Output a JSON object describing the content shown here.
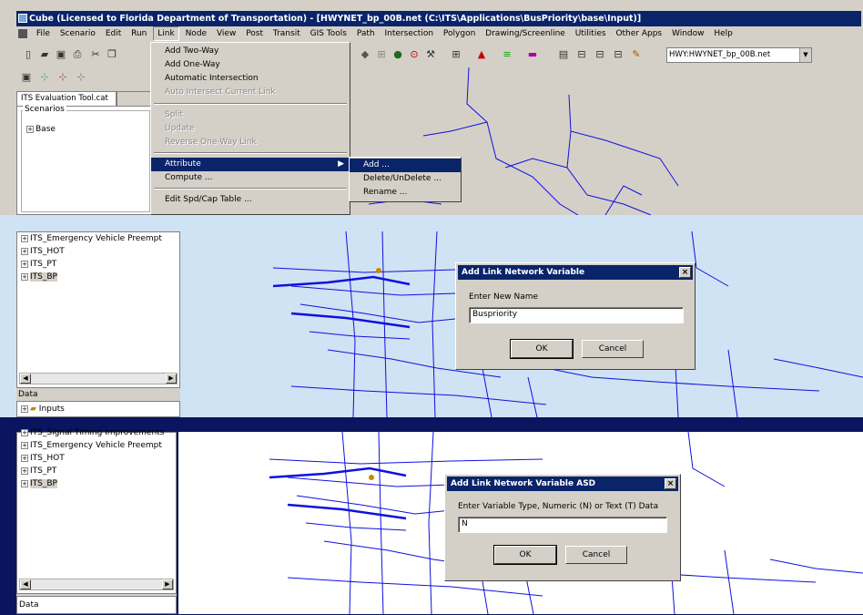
{
  "window": {
    "title": "Cube (Licensed to Florida Department of Transportation) - [HWYNET_bp_00B.net (C:\\ITS\\Applications\\BusPriority\\base\\Input)]"
  },
  "menubar": [
    "File",
    "Scenario",
    "Edit",
    "Run",
    "Link",
    "Node",
    "View",
    "Post",
    "Transit",
    "GIS Tools",
    "Path",
    "Intersection",
    "Polygon",
    "Drawing/Screenline",
    "Utilities",
    "Other Apps",
    "Window",
    "Help"
  ],
  "toolbar": {
    "layer_combo": "HWY:HWYNET_bp_00B.net"
  },
  "catalog_tab": "ITS Evaluation Tool.cat",
  "scenarios": {
    "label": "Scenarios",
    "items": [
      "Base"
    ]
  },
  "link_menu": {
    "items": [
      {
        "label": "Add Two-Way",
        "enabled": true
      },
      {
        "label": "Add One-Way",
        "enabled": true
      },
      {
        "label": "Automatic Intersection",
        "enabled": true
      },
      {
        "label": "Auto Intersect Current Link",
        "enabled": false
      },
      {
        "label": "Split",
        "enabled": false
      },
      {
        "label": "Update",
        "enabled": false
      },
      {
        "label": "Reverse One-Way Link",
        "enabled": false
      },
      {
        "label": "Attribute",
        "enabled": true
      },
      {
        "label": "Compute ...",
        "enabled": true
      },
      {
        "label": "Edit Spd/Cap Table ...",
        "enabled": true
      }
    ]
  },
  "attribute_submenu": [
    "Add ...",
    "Delete/UnDelete ...",
    "Rename ..."
  ],
  "panel2": {
    "tree": [
      "ITS_Emergency Vehicle Preempt",
      "ITS_HOT",
      "ITS_PT",
      "ITS_BP"
    ],
    "data_label": "Data",
    "inputs_label": "Inputs"
  },
  "dialog1": {
    "title": "Add Link Network Variable",
    "prompt": "Enter New Name",
    "value": "Buspriority",
    "ok": "OK",
    "cancel": "Cancel"
  },
  "panel3": {
    "tree_partial": "ITS_Signal Timing Improvements",
    "tree": [
      "ITS_Emergency Vehicle Preempt",
      "ITS_HOT",
      "ITS_PT",
      "ITS_BP"
    ],
    "data_label": "Data"
  },
  "dialog2": {
    "title": "Add Link Network Variable ASD",
    "prompt": "Enter Variable Type, Numeric (N) or Text (T) Data",
    "value": "N",
    "ok": "OK",
    "cancel": "Cancel"
  },
  "colors": {
    "titlebar": "#0a246a",
    "network": "#1010e0",
    "chrome": "#d4d0c8"
  }
}
